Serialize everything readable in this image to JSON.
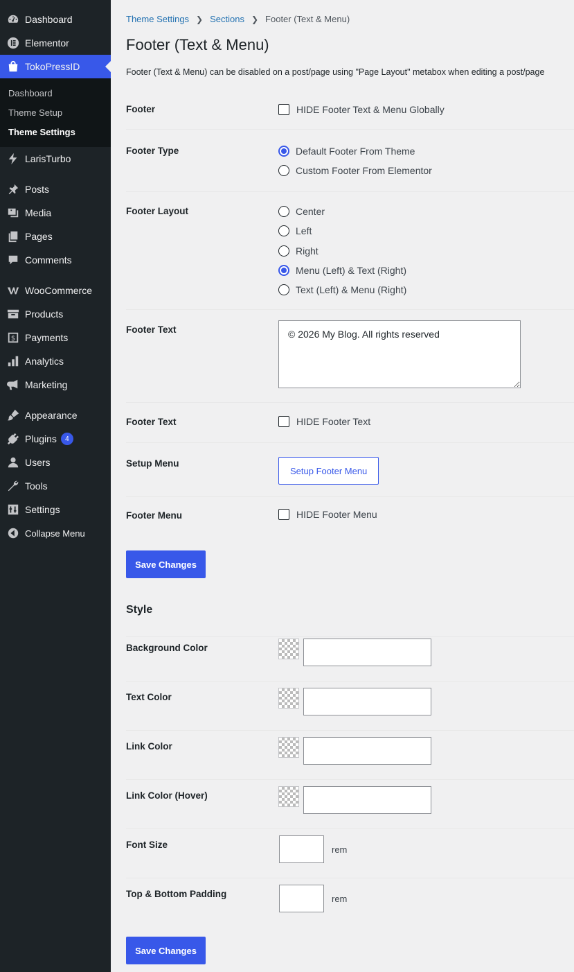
{
  "sidebar": {
    "items": [
      {
        "label": "Dashboard",
        "icon": "dashboard-icon"
      },
      {
        "label": "Elementor",
        "icon": "elementor-icon"
      },
      {
        "label": "TokoPressID",
        "icon": "shopping-bag-icon"
      },
      {
        "label": "LarisTurbo",
        "icon": "turbo-icon"
      },
      {
        "label": "Posts",
        "icon": "pin-icon"
      },
      {
        "label": "Media",
        "icon": "media-icon"
      },
      {
        "label": "Pages",
        "icon": "pages-icon"
      },
      {
        "label": "Comments",
        "icon": "comment-icon"
      },
      {
        "label": "WooCommerce",
        "icon": "woo-icon"
      },
      {
        "label": "Products",
        "icon": "archive-icon"
      },
      {
        "label": "Payments",
        "icon": "dollar-icon"
      },
      {
        "label": "Analytics",
        "icon": "chart-bar-icon"
      },
      {
        "label": "Marketing",
        "icon": "megaphone-icon"
      },
      {
        "label": "Appearance",
        "icon": "brush-icon"
      },
      {
        "label": "Plugins",
        "icon": "plug-icon",
        "badge": "4"
      },
      {
        "label": "Users",
        "icon": "user-icon"
      },
      {
        "label": "Tools",
        "icon": "wrench-icon"
      },
      {
        "label": "Settings",
        "icon": "sliders-icon"
      },
      {
        "label": "Collapse Menu",
        "icon": "collapse-icon"
      }
    ],
    "submenu": [
      {
        "label": "Dashboard"
      },
      {
        "label": "Theme Setup"
      },
      {
        "label": "Theme Settings"
      }
    ]
  },
  "breadcrumb": {
    "items": [
      "Theme Settings",
      "Sections"
    ],
    "current": "Footer (Text & Menu)"
  },
  "page": {
    "title": "Footer (Text & Menu)",
    "description": "Footer (Text & Menu) can be disabled on a post/page using \"Page Layout\" metabox when editing a post/page"
  },
  "form": {
    "footer": {
      "label": "Footer",
      "checkbox": "HIDE Footer Text & Menu Globally"
    },
    "footer_type": {
      "label": "Footer Type",
      "options": [
        "Default Footer From Theme",
        "Custom Footer From Elementor"
      ],
      "selected": 0
    },
    "footer_layout": {
      "label": "Footer Layout",
      "options": [
        "Center",
        "Left",
        "Right",
        "Menu (Left) & Text (Right)",
        "Text (Left) & Menu (Right)"
      ],
      "selected": 3
    },
    "footer_text": {
      "label": "Footer Text",
      "value": "© 2026 My Blog. All rights reserved"
    },
    "footer_text_hide": {
      "label": "Footer Text",
      "checkbox": "HIDE Footer Text"
    },
    "setup_menu": {
      "label": "Setup Menu",
      "button": "Setup Footer Menu"
    },
    "footer_menu": {
      "label": "Footer Menu",
      "checkbox": "HIDE Footer Menu"
    },
    "save_label": "Save Changes"
  },
  "style": {
    "title": "Style",
    "background_color": {
      "label": "Background Color"
    },
    "text_color": {
      "label": "Text Color"
    },
    "link_color": {
      "label": "Link Color"
    },
    "link_color_hover": {
      "label": "Link Color (Hover)"
    },
    "font_size": {
      "label": "Font Size",
      "unit": "rem"
    },
    "padding": {
      "label": "Top & Bottom Padding",
      "unit": "rem"
    },
    "save_label": "Save Changes"
  },
  "colors": {
    "accent": "#3858e9",
    "sidebar_bg": "#1d2327",
    "page_bg": "#f0f0f1"
  }
}
